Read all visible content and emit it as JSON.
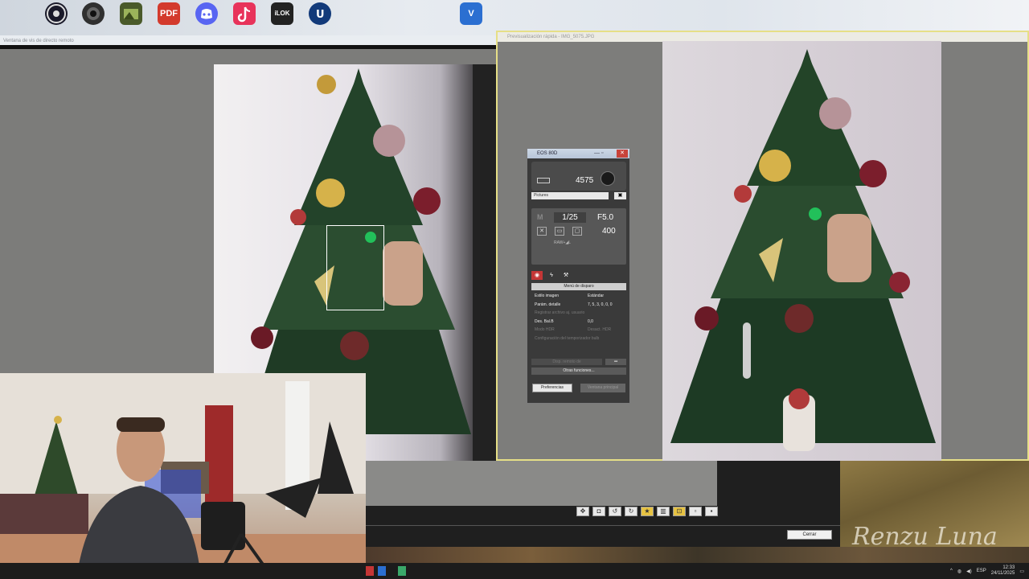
{
  "desktop": {
    "icons": [
      {
        "icon": "obs-icon",
        "color": "#1a1a2a"
      },
      {
        "icon": "camera-app-icon",
        "color": "#303030"
      },
      {
        "icon": "photo-app-icon",
        "color": "#4a5a2a"
      },
      {
        "icon": "pdf-icon",
        "color": "#d33a2c",
        "glyph": "PDF"
      },
      {
        "icon": "discord-icon",
        "color": "#5865f2"
      },
      {
        "icon": "tiktok-icon",
        "color": "#e8335a"
      },
      {
        "icon": "ilok-icon",
        "color": "#222222",
        "glyph": "iLOK"
      },
      {
        "icon": "unreal-icon",
        "color": "#123a7a"
      },
      {
        "icon": "visio-icon",
        "color": "#2b6fd1",
        "glyph": "V"
      }
    ]
  },
  "liveview": {
    "title": "Ventana de vis de directo remoto"
  },
  "preview": {
    "title": "Previsualización rápida - IMG_5075.JPG"
  },
  "eos": {
    "title": "EOS 80D",
    "shots_remaining": "4575",
    "folder": "Pictures",
    "mode": "M",
    "shutter": "1/25",
    "aperture": "F5.0",
    "iso": "400",
    "raw_label": "RAW+◢L",
    "menu_title": "Menú de disparo",
    "menu": [
      {
        "label": "Estilo imagen",
        "value": "Estándar",
        "enabled": true
      },
      {
        "label": "Parám. detalle",
        "value": "7, 5, 3, 0, 0, 0",
        "enabled": true
      },
      {
        "label": "Registrar archivo aj. usuario",
        "value": "",
        "enabled": false
      },
      {
        "label": "Des. Bal.B",
        "value": "0,0",
        "enabled": true
      },
      {
        "label": "Modo HDR",
        "value": "Desact. HDR",
        "enabled": false
      },
      {
        "label": "Configuración del temporizador bulb",
        "value": "",
        "enabled": false
      }
    ],
    "dial_button": "Disp. remoto de",
    "other_functions": "Otras funciones...",
    "preferences": "Preferencias",
    "main_window": "Ventana principal"
  },
  "bottom": {
    "close_button": "Cerrar",
    "signature": "Renzu Luna"
  },
  "taskbar": {
    "lang": "ESP",
    "time": "12:33",
    "date": "24/11/2025"
  }
}
